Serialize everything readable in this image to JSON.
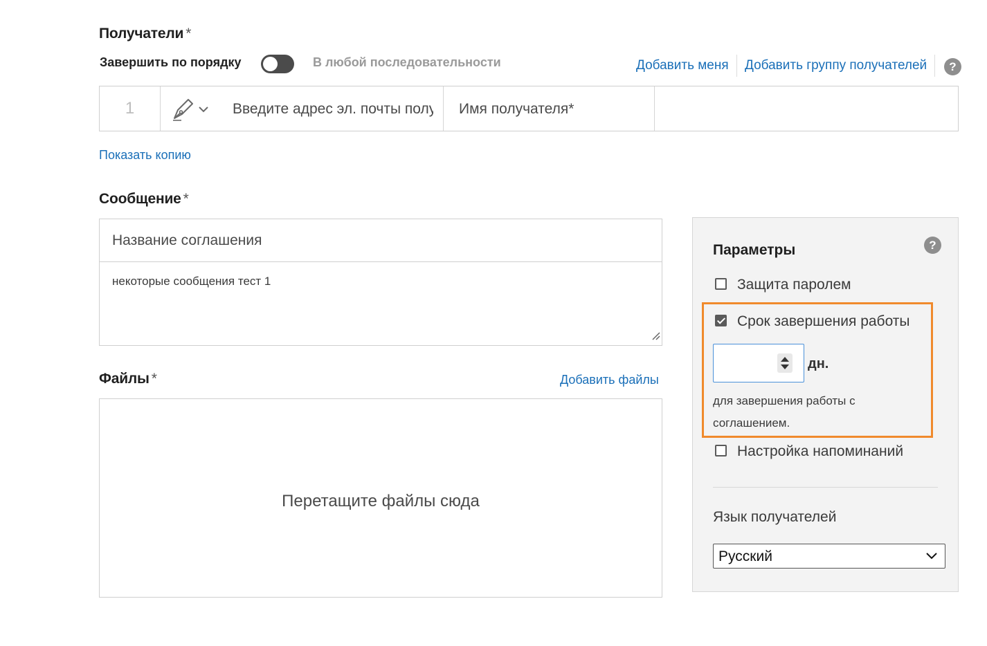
{
  "recipients": {
    "title": "Получатели",
    "required_mark": "*",
    "order_label": "Завершить по порядку",
    "any_order_label": "В любой последовательности",
    "add_me": "Добавить меня",
    "add_group": "Добавить группу получателей",
    "help": "?",
    "row": {
      "number": "1",
      "email_placeholder": "Введите адрес эл. почты получателя",
      "name_placeholder": "Имя получателя*"
    },
    "show_copy": "Показать копию"
  },
  "message": {
    "title": "Сообщение",
    "required_mark": "*",
    "agreement_placeholder": "Название соглашения",
    "body": "некоторые сообщения тест 1"
  },
  "files": {
    "title": "Файлы",
    "required_mark": "*",
    "add_files": "Добавить файлы",
    "drop_hint": "Перетащите файлы сюда"
  },
  "params": {
    "title": "Параметры",
    "help": "?",
    "password_label": "Защита паролем",
    "password_checked": false,
    "deadline_label": "Срок завершения работы",
    "deadline_checked": true,
    "days_value": "",
    "days_unit": "дн.",
    "deadline_hint": "для завершения работы с соглашением.",
    "reminders_label": "Настройка напоминаний",
    "reminders_checked": false,
    "language_label": "Язык получателей",
    "language_value": "Русский"
  },
  "colors": {
    "link": "#1a6fb8",
    "highlight": "#f08a2c",
    "focus_border": "#4a90d9"
  }
}
